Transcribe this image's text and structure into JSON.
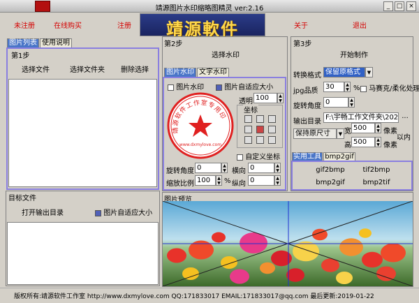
{
  "window": {
    "title": "靖源图片水印缩略图精灵 ver:2.16"
  },
  "menu": {
    "unregistered": "未注册",
    "buy_online": "在线购买",
    "register": "注册",
    "about": "关于",
    "exit": "退出"
  },
  "banner": {
    "text": "靖源軟件"
  },
  "left": {
    "tabs": [
      "图片列表",
      "使用说明"
    ],
    "step": "第1步",
    "select_file": "选择文件",
    "select_folder": "选择文件夹",
    "delete_selection": "删除选择",
    "target_title": "目标文件",
    "open_output": "打开输出目录",
    "auto_fit_label": "图片自适应大小"
  },
  "middle": {
    "step": "第2步",
    "select_watermark": "选择水印",
    "tabs": [
      "图片水印",
      "文字水印"
    ],
    "image_wm_label": "图片水印",
    "auto_fit_label": "图片自适应大小",
    "transparency_label": "透明",
    "transparency_value": "100",
    "coords_label": "坐标",
    "custom_coords_label": "自定义坐标",
    "rotation_label": "旋转角度",
    "rotation_value": "0",
    "horizontal_label": "横向",
    "horizontal_value": "0",
    "scale_label": "缩放比例",
    "scale_value": "100",
    "percent": "%",
    "vertical_label": "纵向",
    "vertical_value": "0",
    "stamp": {
      "ring_text": "靖源软件工作室专用印",
      "bottom_text": "www.dxmylove.com",
      "color": "#e02020"
    }
  },
  "right": {
    "step": "第3步",
    "start": "开始制作",
    "format_label": "转换格式",
    "format_value": "保留原格式",
    "jpg_quality_label": "jpg品质",
    "jpg_quality_value": "30",
    "jpg_quality_unit": "%",
    "mosaic_label": "马赛克/柔化处理",
    "rotate_label": "旋转角度",
    "rotate_value": "0",
    "output_label": "输出目录",
    "output_value": "F:\\宇畅工作文件夹\\202",
    "browse": "...",
    "keep_size": "保持原尺寸",
    "width_label": "宽",
    "width_value": "500",
    "height_label": "高",
    "height_value": "500",
    "pixel_unit": "像素",
    "within": "以内",
    "tools_tabs": [
      "实用工具",
      "bmp2gif"
    ],
    "tools": [
      "gif2bmp",
      "tif2bmp",
      "bmp2gif",
      "bmp2tif"
    ]
  },
  "preview": {
    "title": "图片预览"
  },
  "status": {
    "text": "版权所有:靖源软件工作室 http://www.dxmylove.com QQ:171833017 EMAIL:171833017@qq.com 最后更新:2019-01-22"
  }
}
